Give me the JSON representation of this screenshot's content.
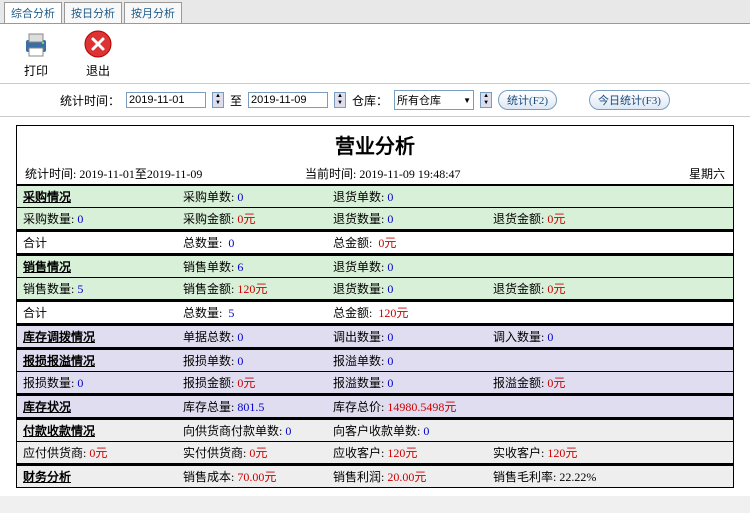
{
  "tabs": [
    "综合分析",
    "按日分析",
    "按月分析"
  ],
  "toolbar": {
    "print": "打印",
    "exit": "退出"
  },
  "filter": {
    "stat_time_label": "统计时间：",
    "date_from": "2019-11-01",
    "to": "至",
    "date_to": "2019-11-09",
    "warehouse_label": "仓库：",
    "warehouse_value": "所有仓库",
    "btn_stat": "统计(F2)",
    "btn_today": "今日统计(F3)"
  },
  "report": {
    "title": "营业分析",
    "meta_stat": "统计时间: 2019-11-01至2019-11-09",
    "meta_current": "当前时间: 2019-11-09 19:48:47",
    "meta_weekday": "星期六",
    "purchase": {
      "header": "采购情况",
      "r1c2l": "采购单数:",
      "r1c2v": "0",
      "r1c3l": "退货单数:",
      "r1c3v": "0",
      "r2c1l": "采购数量:",
      "r2c1v": "0",
      "r2c2l": "采购金额:",
      "r2c2v": "0元",
      "r2c3l": "退货数量:",
      "r2c3v": "0",
      "r2c4l": "退货金额:",
      "r2c4v": "0元",
      "tot": "合计",
      "totc2l": "总数量:",
      "totc2v": "0",
      "totc3l": "总金额:",
      "totc3v": "0元"
    },
    "sales": {
      "header": "销售情况",
      "r1c2l": "销售单数:",
      "r1c2v": "6",
      "r1c3l": "退货单数:",
      "r1c3v": "0",
      "r2c1l": "销售数量:",
      "r2c1v": "5",
      "r2c2l": "销售金额:",
      "r2c2v": "120元",
      "r2c3l": "退货数量:",
      "r2c3v": "0",
      "r2c4l": "退货金额:",
      "r2c4v": "0元",
      "tot": "合计",
      "totc2l": "总数量:",
      "totc2v": "5",
      "totc3l": "总金额:",
      "totc3v": "120元"
    },
    "transfer": {
      "header": "库存调拨情况",
      "c2l": "单据总数:",
      "c2v": "0",
      "c3l": "调出数量:",
      "c3v": "0",
      "c4l": "调入数量:",
      "c4v": "0"
    },
    "lossgain": {
      "header": "报损报溢情况",
      "r1c2l": "报损单数:",
      "r1c2v": "0",
      "r1c3l": "报溢单数:",
      "r1c3v": "0",
      "r2c1l": "报损数量:",
      "r2c1v": "0",
      "r2c2l": "报损金额:",
      "r2c2v": "0元",
      "r2c3l": "报溢数量:",
      "r2c3v": "0",
      "r2c4l": "报溢金额:",
      "r2c4v": "0元"
    },
    "stock": {
      "header": "库存状况",
      "c2l": "库存总量:",
      "c2v": "801.5",
      "c3l": "库存总价:",
      "c3v": "14980.5498元"
    },
    "payment": {
      "header": "付款收款情况",
      "r1c2l": "向供货商付款单数:",
      "r1c2v": "0",
      "r1c3l": "向客户收款单数:",
      "r1c3v": "0",
      "r2c1l": "应付供货商:",
      "r2c1v": "0元",
      "r2c2l": "实付供货商:",
      "r2c2v": "0元",
      "r2c3l": "应收客户:",
      "r2c3v": "120元",
      "r2c4l": "实收客户:",
      "r2c4v": "120元"
    },
    "finance": {
      "header": "财务分析",
      "c2l": "销售成本:",
      "c2v": "70.00元",
      "c3l": "销售利润:",
      "c3v": "20.00元",
      "c4l": "销售毛利率:",
      "c4v": "22.22%"
    }
  }
}
